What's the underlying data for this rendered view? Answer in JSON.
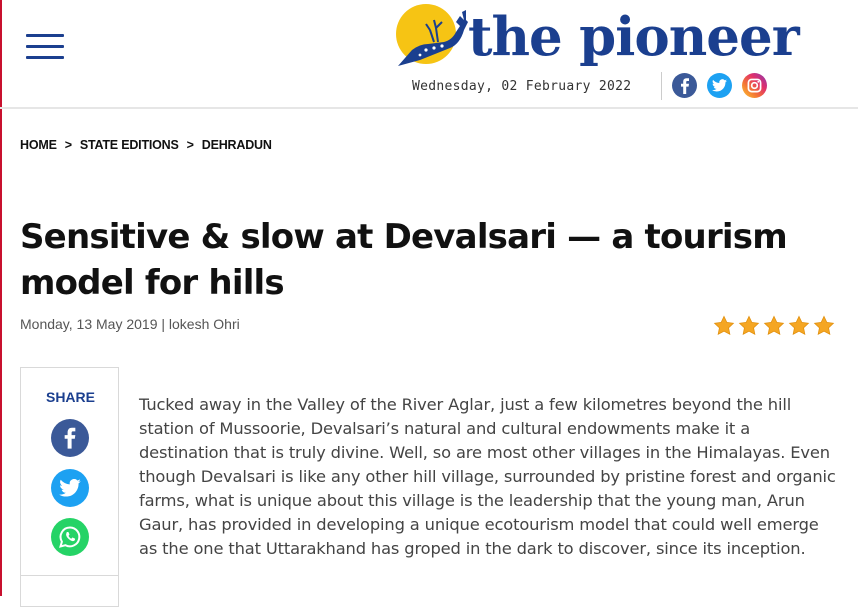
{
  "header": {
    "logo_text": "the pioneer",
    "date": "Wednesday, 02 February 2022",
    "social": [
      "facebook-icon",
      "twitter-icon",
      "instagram-icon"
    ]
  },
  "breadcrumb": {
    "items": [
      "HOME",
      "STATE EDITIONS",
      "DEHRADUN"
    ],
    "separator": ">"
  },
  "article": {
    "title": "Sensitive & slow at Devalsari — a tourism model for hills",
    "meta": "Monday, 13 May 2019 | lokesh Ohri",
    "rating": 5,
    "body": "Tucked away in the Valley of the River Aglar, just a few kilometres beyond the hill station of Mussoorie, Devalsari’s natural and cultural endowments make it a destination that is truly divine. Well, so are most other villages in the Himalayas. Even though Devalsari is like any other hill village, surrounded by pristine forest and organic farms, what is unique about this village is the leadership that the young man, Arun Gaur, has provided in developing a unique ecotourism model that could well emerge as the one that Uttarakhand has groped in the dark to discover, since its inception."
  },
  "share": {
    "label": "SHARE",
    "icons": [
      "facebook-icon",
      "twitter-icon",
      "whatsapp-icon"
    ]
  },
  "colors": {
    "brand_blue": "#1b3f8f",
    "logo_yellow": "#f6c414",
    "star": "#f5a623",
    "accent_red": "#c8102e"
  }
}
